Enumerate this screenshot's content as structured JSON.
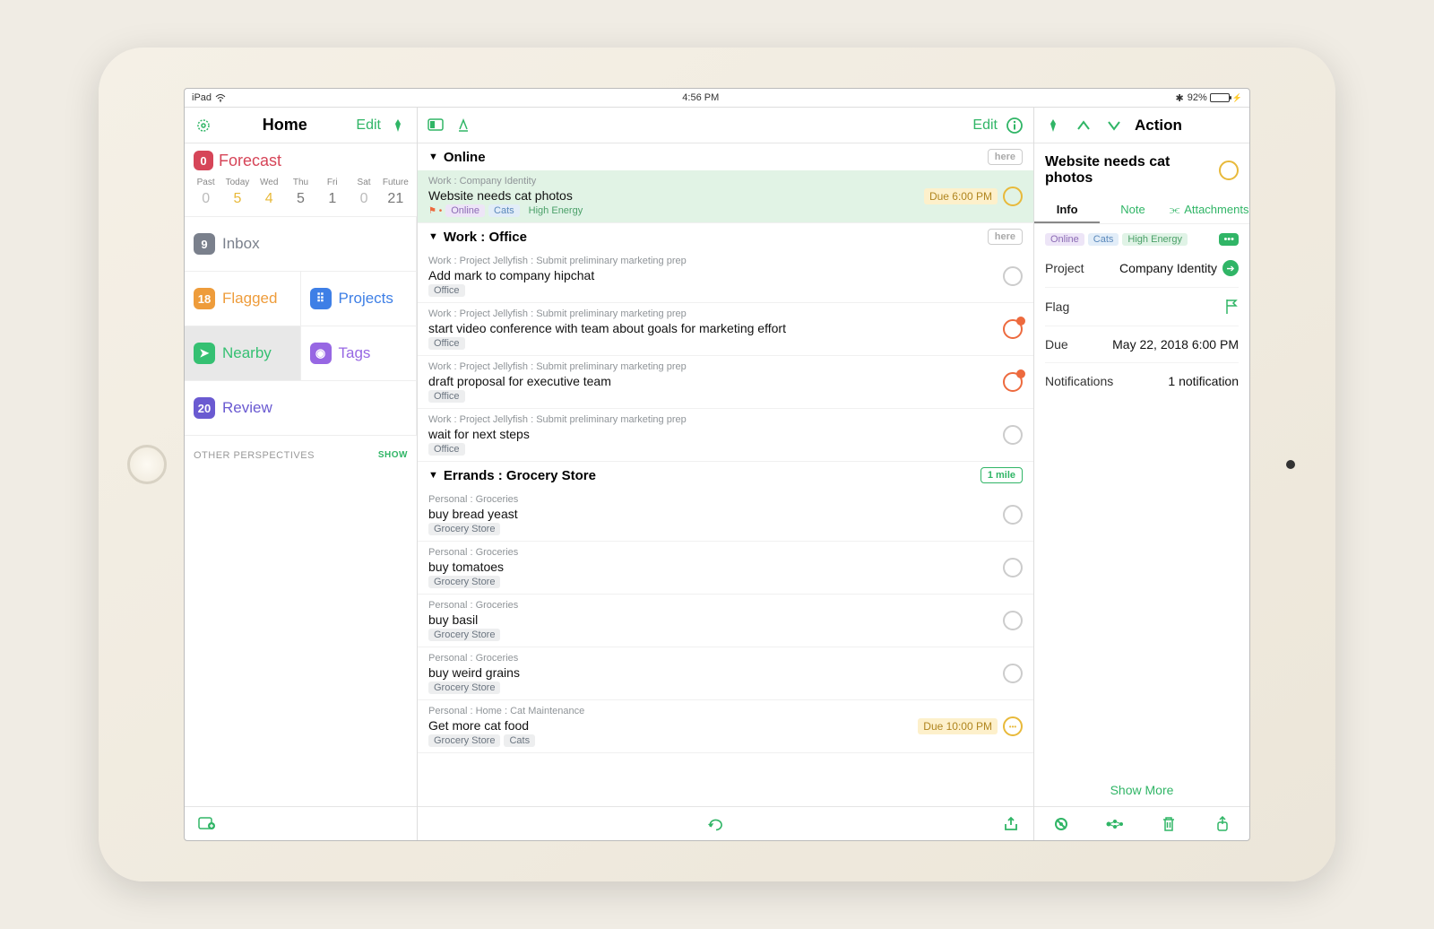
{
  "status": {
    "device": "iPad",
    "time": "4:56 PM",
    "battery": "92%"
  },
  "sidebar": {
    "title": "Home",
    "edit": "Edit",
    "forecast": {
      "badge": "0",
      "label": "Forecast"
    },
    "days": [
      {
        "l": "Past",
        "n": "0"
      },
      {
        "l": "Today",
        "n": "5"
      },
      {
        "l": "Wed",
        "n": "4"
      },
      {
        "l": "Thu",
        "n": "5"
      },
      {
        "l": "Fri",
        "n": "1"
      },
      {
        "l": "Sat",
        "n": "0"
      },
      {
        "l": "Future",
        "n": "21"
      }
    ],
    "nav": {
      "inbox": {
        "n": "9",
        "label": "Inbox"
      },
      "flagged": {
        "n": "18",
        "label": "Flagged"
      },
      "projects": {
        "label": "Projects"
      },
      "nearby": {
        "label": "Nearby"
      },
      "tags": {
        "label": "Tags"
      },
      "review": {
        "n": "20",
        "label": "Review"
      }
    },
    "other": "OTHER PERSPECTIVES",
    "show": "SHOW"
  },
  "main": {
    "edit": "Edit",
    "sections": [
      {
        "title": "Online",
        "btn": "here",
        "tasks": [
          {
            "ctx": "Work : Company Identity",
            "title": "Website needs cat photos",
            "tags": [
              {
                "t": "Online",
                "c": "purple"
              },
              {
                "t": "Cats",
                "c": "blue"
              },
              {
                "t": "High Energy",
                "c": "green"
              }
            ],
            "due": "Due 6:00 PM",
            "circle": "gold",
            "sel": true,
            "flagdot": true
          }
        ]
      },
      {
        "title": "Work : Office",
        "btn": "here",
        "tasks": [
          {
            "ctx": "Work : Project Jellyfish : Submit preliminary marketing prep",
            "title": "Add mark to company hipchat",
            "tags": [
              {
                "t": "Office"
              }
            ],
            "circle": "plain"
          },
          {
            "ctx": "Work : Project Jellyfish : Submit preliminary marketing prep",
            "title": "start video conference with team about goals for marketing effort",
            "tags": [
              {
                "t": "Office"
              }
            ],
            "circle": "red"
          },
          {
            "ctx": "Work : Project Jellyfish : Submit preliminary marketing prep",
            "title": "draft proposal for executive team",
            "tags": [
              {
                "t": "Office"
              }
            ],
            "circle": "red"
          },
          {
            "ctx": "Work : Project Jellyfish : Submit preliminary marketing prep",
            "title": "wait for next steps",
            "tags": [
              {
                "t": "Office"
              }
            ],
            "circle": "plain"
          }
        ]
      },
      {
        "title": "Errands : Grocery Store",
        "btn": "1 mile",
        "mile": true,
        "tasks": [
          {
            "ctx": "Personal : Groceries",
            "title": "buy bread yeast",
            "tags": [
              {
                "t": "Grocery Store"
              }
            ],
            "circle": "plain"
          },
          {
            "ctx": "Personal : Groceries",
            "title": "buy tomatoes",
            "tags": [
              {
                "t": "Grocery Store"
              }
            ],
            "circle": "plain"
          },
          {
            "ctx": "Personal : Groceries",
            "title": "buy basil",
            "tags": [
              {
                "t": "Grocery Store"
              }
            ],
            "circle": "plain"
          },
          {
            "ctx": "Personal : Groceries",
            "title": "buy weird grains",
            "tags": [
              {
                "t": "Grocery Store"
              }
            ],
            "circle": "plain"
          },
          {
            "ctx": "Personal : Home : Cat Maintenance",
            "title": "Get more cat food",
            "tags": [
              {
                "t": "Grocery Store"
              },
              {
                "t": "Cats"
              }
            ],
            "due": "Due 10:00 PM",
            "circle": "goldd"
          }
        ]
      }
    ]
  },
  "inspector": {
    "header": "Action",
    "title": "Website needs cat photos",
    "tabs": {
      "info": "Info",
      "note": "Note",
      "att": "Attachments"
    },
    "tags": [
      {
        "t": "Online",
        "c": "purple"
      },
      {
        "t": "Cats",
        "c": "blue"
      },
      {
        "t": "High Energy",
        "c": "green"
      }
    ],
    "rows": {
      "project": {
        "k": "Project",
        "v": "Company Identity"
      },
      "flag": {
        "k": "Flag"
      },
      "due": {
        "k": "Due",
        "v": "May 22, 2018  6:00 PM"
      },
      "notif": {
        "k": "Notifications",
        "v": "1 notification"
      }
    },
    "showmore": "Show More"
  }
}
